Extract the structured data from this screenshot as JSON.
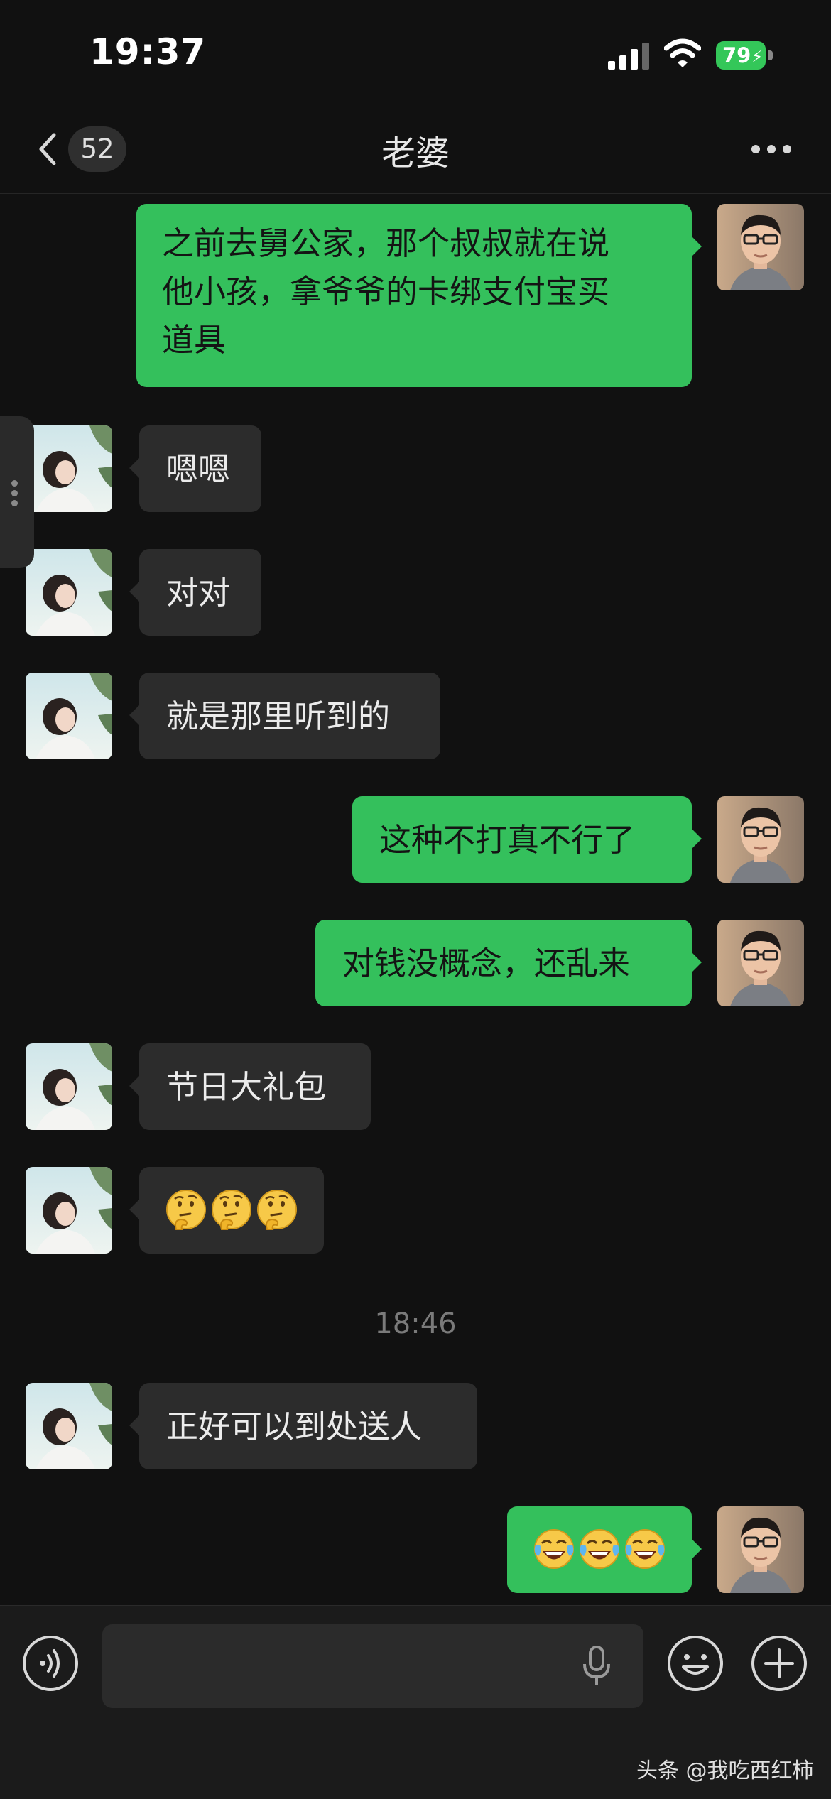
{
  "status_bar": {
    "time": "19:37",
    "battery": "79"
  },
  "nav": {
    "unread_count": "52",
    "title": "老婆"
  },
  "messages": [
    {
      "side": "out",
      "lines": [
        "之前去舅公家，那个叔叔就在说",
        "他小孩，拿爷爷的卡绑支付宝买",
        "道具"
      ]
    },
    {
      "side": "in",
      "text": "嗯嗯"
    },
    {
      "side": "in",
      "text": "对对"
    },
    {
      "side": "in",
      "text": "就是那里听到的"
    },
    {
      "side": "out",
      "text": "这种不打真不行了"
    },
    {
      "side": "out",
      "text": "对钱没概念，还乱来"
    },
    {
      "side": "in",
      "text": "节日大礼包"
    },
    {
      "side": "in",
      "emoji": [
        "thinking-face",
        "thinking-face",
        "thinking-face"
      ]
    },
    {
      "timestamp": "18:46"
    },
    {
      "side": "in",
      "text": "正好可以到处送人"
    },
    {
      "side": "out",
      "emoji": [
        "tears-of-joy",
        "tears-of-joy",
        "tears-of-joy"
      ]
    }
  ],
  "icons": {
    "back": "chevron-left-icon",
    "more": "more-dots-icon",
    "voice": "voice-icon",
    "mic": "microphone-icon",
    "emoji": "emoji-icon",
    "plus": "plus-icon"
  },
  "colors": {
    "outgoing_bubble": "#34c05c",
    "incoming_bubble": "#2c2c2c",
    "background": "#111111",
    "battery": "#34c759"
  },
  "watermark": "头条 @我吃西红柿"
}
